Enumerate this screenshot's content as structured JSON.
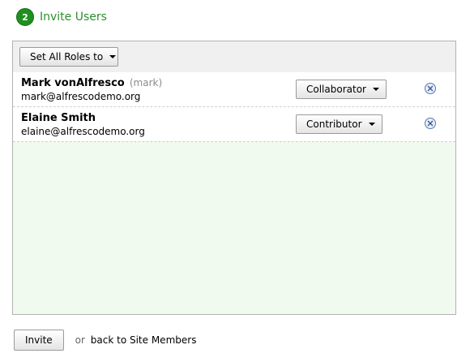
{
  "step": {
    "number": "2",
    "title": "Invite Users"
  },
  "toolbar": {
    "set_all_roles_label": "Set All Roles to"
  },
  "users": [
    {
      "name": "Mark vonAlfresco",
      "username": "(mark)",
      "email": "mark@alfrescodemo.org",
      "role": "Collaborator"
    },
    {
      "name": "Elaine Smith",
      "username": "",
      "email": "elaine@alfrescodemo.org",
      "role": "Contributor"
    }
  ],
  "footer": {
    "invite_label": "Invite",
    "or_text": "or",
    "back_link_label": "back to Site Members"
  },
  "colors": {
    "accent_green": "#1f8f1f",
    "panel_background": "#f1faee"
  },
  "icons": {
    "remove": "close-circle-icon",
    "dropdown": "caret-down-icon"
  }
}
